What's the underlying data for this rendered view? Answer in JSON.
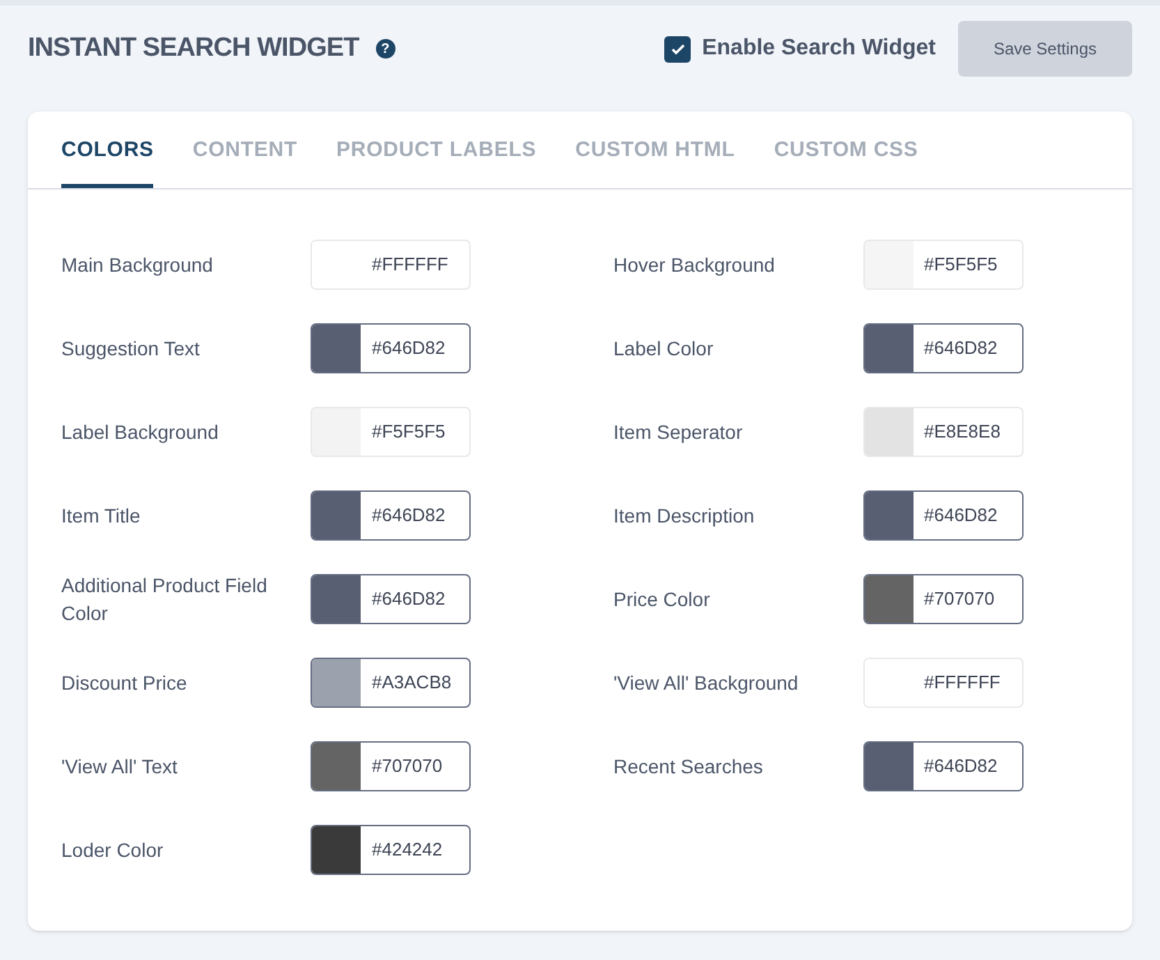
{
  "header": {
    "title": "INSTANT SEARCH WIDGET",
    "help_icon": "?",
    "enable_checkbox": {
      "label": "Enable Search Widget",
      "checked": true
    },
    "save_button": "Save Settings"
  },
  "tabs": [
    {
      "label": "COLORS",
      "selected": true
    },
    {
      "label": "CONTENT",
      "selected": false
    },
    {
      "label": "PRODUCT LABELS",
      "selected": false
    },
    {
      "label": "CUSTOM HTML",
      "selected": false
    },
    {
      "label": "CUSTOM CSS",
      "selected": false
    }
  ],
  "colors": [
    {
      "label": "Main Background",
      "value": "#FFFFFF",
      "color": "#ffffff"
    },
    {
      "label": "Hover Background",
      "value": "#F5F5F5",
      "color": "#f5f5f5"
    },
    {
      "label": "Suggestion Text",
      "value": "#646D82",
      "color": "#585f72"
    },
    {
      "label": "Label Color",
      "value": "#646D82",
      "color": "#585f72"
    },
    {
      "label": "Label Background",
      "value": "#F5F5F5",
      "color": "#f3f3f3"
    },
    {
      "label": "Item Seperator",
      "value": "#E8E8E8",
      "color": "#e3e3e3"
    },
    {
      "label": "Item Title",
      "value": "#646D82",
      "color": "#585f72"
    },
    {
      "label": "Item Description",
      "value": "#646D82",
      "color": "#585f72"
    },
    {
      "label": "Additional Product Field Color",
      "value": "#646D82",
      "color": "#585f72"
    },
    {
      "label": "Price Color",
      "value": "#707070",
      "color": "#646464"
    },
    {
      "label": "Discount Price",
      "value": "#A3ACB8",
      "color": "#9ca2ad"
    },
    {
      "label": "'View All' Background",
      "value": "#FFFFFF",
      "color": "#ffffff"
    },
    {
      "label": "'View All' Text",
      "value": "#707070",
      "color": "#646464"
    },
    {
      "label": "Recent Searches",
      "value": "#646D82",
      "color": "#585f72"
    },
    {
      "label": "Loder Color",
      "value": "#424242",
      "color": "#3a3a3a"
    }
  ]
}
